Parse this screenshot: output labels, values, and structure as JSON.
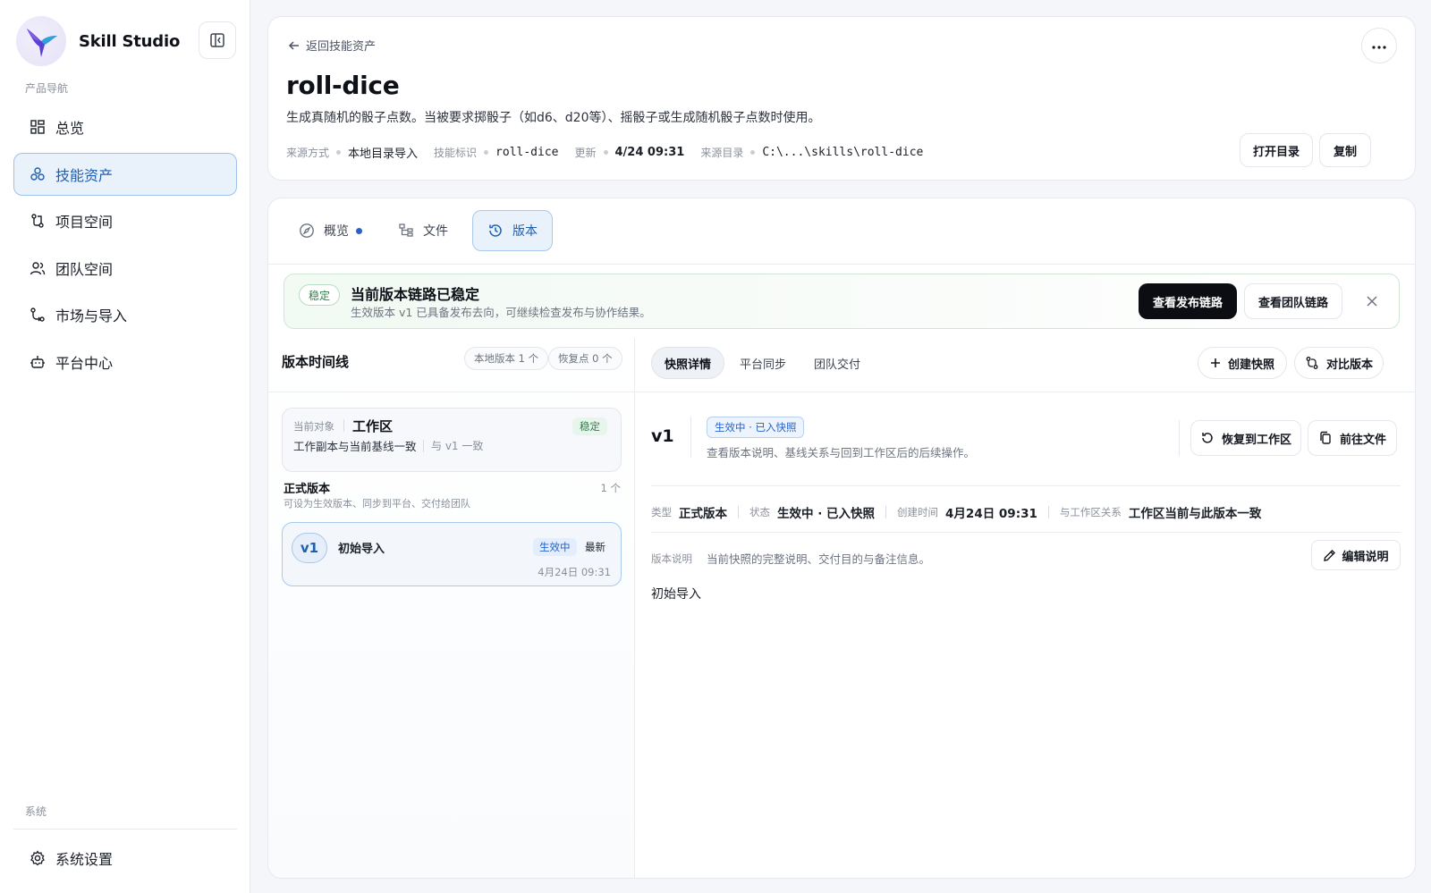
{
  "brand": {
    "name": "Skill Studio"
  },
  "sidebar": {
    "section_label": "产品导航",
    "items": [
      {
        "label": "总览",
        "icon": "dashboard-icon",
        "active": false
      },
      {
        "label": "技能资产",
        "icon": "skills-icon",
        "active": true
      },
      {
        "label": "项目空间",
        "icon": "project-icon",
        "active": false
      },
      {
        "label": "团队空间",
        "icon": "team-icon",
        "active": false
      },
      {
        "label": "市场与导入",
        "icon": "market-icon",
        "active": false
      },
      {
        "label": "平台中心",
        "icon": "platform-icon",
        "active": false
      }
    ],
    "system_label": "系统",
    "settings_label": "系统设置"
  },
  "header": {
    "back_label": "返回技能资产",
    "title": "roll-dice",
    "description": "生成真随机的骰子点数。当被要求掷骰子（如d6、d20等）、摇骰子或生成随机骰子点数时使用。",
    "meta": {
      "source_label": "来源方式",
      "source_value": "本地目录导入",
      "id_label": "技能标识",
      "id_value": "roll-dice",
      "updated_label": "更新",
      "updated_value": "4/24 09:31",
      "dir_label": "来源目录",
      "dir_value": "C:\\...\\skills\\roll-dice"
    },
    "open_dir_label": "打开目录",
    "copy_label": "复制"
  },
  "tabs": [
    {
      "label": "概览",
      "icon": "compass-icon",
      "active": false,
      "dot": true
    },
    {
      "label": "文件",
      "icon": "file-tree-icon",
      "active": false,
      "dot": false
    },
    {
      "label": "版本",
      "icon": "history-icon",
      "active": true,
      "dot": false
    }
  ],
  "banner": {
    "badge": "稳定",
    "title": "当前版本链路已稳定",
    "subtitle": "生效版本 v1 已具备发布去向，可继续检查发布与协作结果。",
    "primary_label": "查看发布链路",
    "secondary_label": "查看团队链路"
  },
  "timeline": {
    "title": "版本时间线",
    "local_versions": "本地版本 1 个",
    "restore_points": "恢复点 0 个",
    "workspace": {
      "label": "当前对象",
      "name": "工作区",
      "badge": "稳定",
      "desc": "工作副本与当前基线一致",
      "consistent": "与 v1 一致"
    },
    "section_title": "正式版本",
    "section_count": "1 个",
    "section_sub": "可设为生效版本、同步到平台、交付给团队",
    "versions": [
      {
        "tag": "v1",
        "name": "初始导入",
        "status": "生效中",
        "latest": "最新",
        "time": "4月24日 09:31"
      }
    ]
  },
  "detail": {
    "subtabs": [
      {
        "label": "快照详情",
        "active": true
      },
      {
        "label": "平台同步",
        "active": false
      },
      {
        "label": "团队交付",
        "active": false
      }
    ],
    "create_snapshot_label": "创建快照",
    "compare_label": "对比版本",
    "version_tag": "v1",
    "status_badge": "生效中 · 已入快照",
    "version_desc": "查看版本说明、基线关系与回到工作区后的后续操作。",
    "restore_label": "恢复到工作区",
    "goto_files_label": "前往文件",
    "info": {
      "type_label": "类型",
      "type_value": "正式版本",
      "state_label": "状态",
      "state_value": "生效中 · 已入快照",
      "created_label": "创建时间",
      "created_value": "4月24日 09:31",
      "relation_label": "与工作区关系",
      "relation_value": "工作区当前与此版本一致"
    },
    "notes_label": "版本说明",
    "notes_hint": "当前快照的完整说明、交付目的与备注信息。",
    "edit_label": "编辑说明",
    "notes_body": "初始导入"
  }
}
